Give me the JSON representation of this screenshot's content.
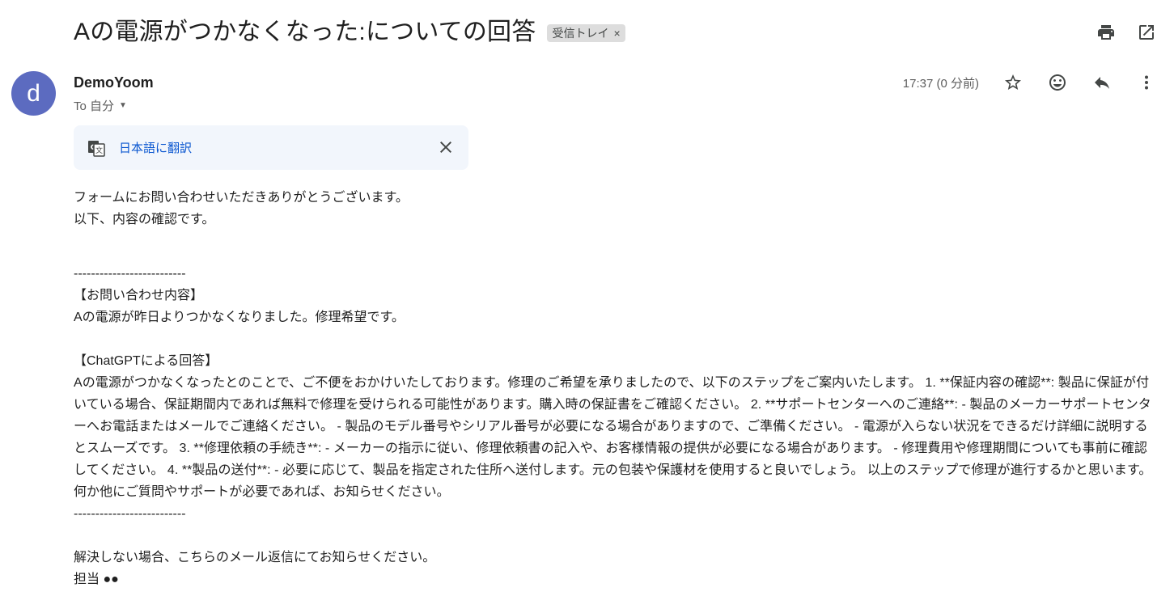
{
  "email": {
    "subject": "Aの電源がつかなくなった:についての回答",
    "label": "受信トレイ",
    "label_close": "×",
    "sender_initial": "d",
    "sender_name": "DemoYoom",
    "recipient": "To 自分",
    "timestamp": "17:37 (0 分前)"
  },
  "icons": {
    "print": "print-icon",
    "open_new_window": "open-in-new-window-icon",
    "star": "star-icon",
    "emoji": "emoji-reaction-icon",
    "reply": "reply-icon",
    "more": "more-vert-icon",
    "translate": "translate-icon",
    "close": "close-icon"
  },
  "translate_bar": {
    "link_text": "日本語に翻訳"
  },
  "body": {
    "line1": "フォームにお問い合わせいただきありがとうございます。",
    "line2": "以下、内容の確認です。",
    "divider_top": "--------------------------",
    "inquiry_heading": "【お問い合わせ内容】",
    "inquiry_text": "Aの電源が昨日よりつかなくなりました。修理希望です。",
    "answer_heading": "【ChatGPTによる回答】",
    "answer_text": "Aの電源がつかなくなったとのことで、ご不便をおかけいたしております。修理のご希望を承りましたので、以下のステップをご案内いたします。 1. **保証内容の確認**: 製品に保証が付いている場合、保証期間内であれば無料で修理を受けられる可能性があります。購入時の保証書をご確認ください。 2. **サポートセンターへのご連絡**: - 製品のメーカーサポートセンターへお電話またはメールでご連絡ください。 - 製品のモデル番号やシリアル番号が必要になる場合がありますので、ご準備ください。 - 電源が入らない状況をできるだけ詳細に説明するとスムーズです。 3. **修理依頼の手続き**: - メーカーの指示に従い、修理依頼書の記入や、お客様情報の提供が必要になる場合があります。 - 修理費用や修理期間についても事前に確認してください。 4. **製品の送付**: - 必要に応じて、製品を指定された住所へ送付します。元の包装や保護材を使用すると良いでしょう。 以上のステップで修理が進行するかと思います。何か他にご質問やサポートが必要であれば、お知らせください。",
    "divider_bottom": "--------------------------",
    "closing1": "解決しない場合、こちらのメール返信にてお知らせください。",
    "closing2": "担当 ●●",
    "trimmed": "..."
  }
}
